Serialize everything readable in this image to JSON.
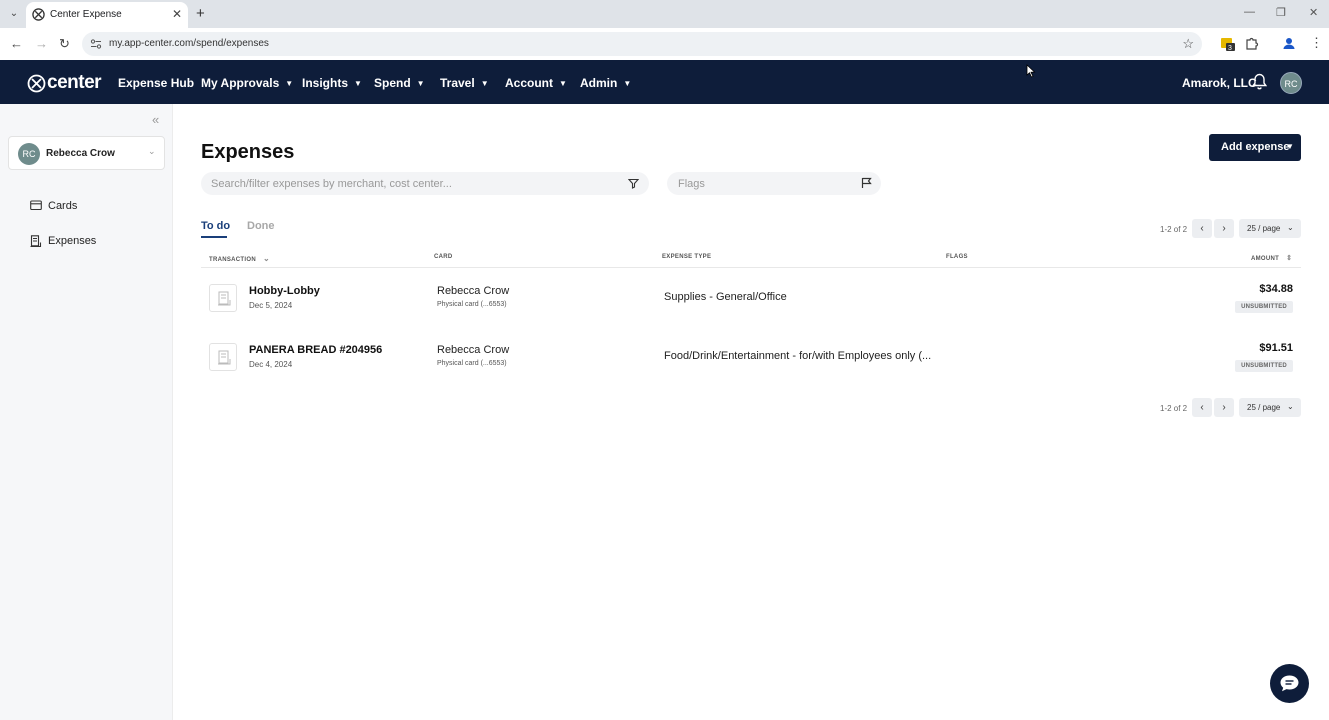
{
  "browser": {
    "tab_title": "Center Expense",
    "url": "my.app-center.com/spend/expenses",
    "extension_badge": "3"
  },
  "nav": {
    "brand": "center",
    "items": [
      {
        "label": "Expense Hub",
        "has_caret": false
      },
      {
        "label": "My Approvals",
        "has_caret": true
      },
      {
        "label": "Insights",
        "has_caret": true
      },
      {
        "label": "Spend",
        "has_caret": true
      },
      {
        "label": "Travel",
        "has_caret": true
      },
      {
        "label": "Account",
        "has_caret": true
      },
      {
        "label": "Admin",
        "has_caret": true
      }
    ],
    "org": "Amarok, LLC",
    "avatar_initials": "RC"
  },
  "sidebar": {
    "user": {
      "initials": "RC",
      "name": "Rebecca Crow"
    },
    "links": [
      {
        "label": "Cards",
        "icon": "credit-card-icon"
      },
      {
        "label": "Expenses",
        "icon": "receipt-icon"
      }
    ]
  },
  "main": {
    "title": "Expenses",
    "add_button": "Add expense",
    "search_placeholder": "Search/filter expenses by merchant, cost center...",
    "flags_placeholder": "Flags",
    "tabs": [
      "To do",
      "Done"
    ],
    "pager": {
      "count": "1-2 of 2",
      "page_size": "25 / page"
    },
    "columns": [
      "TRANSACTION",
      "CARD",
      "EXPENSE TYPE",
      "FLAGS",
      "AMOUNT"
    ],
    "rows": [
      {
        "merchant": "Hobby-Lobby",
        "date": "Dec 5, 2024",
        "card_holder": "Rebecca Crow",
        "card_desc": "Physical card (...6553)",
        "expense_type": "Supplies - General/Office",
        "amount": "$34.88",
        "status": "UNSUBMITTED"
      },
      {
        "merchant": "PANERA BREAD #204956",
        "date": "Dec 4, 2024",
        "card_holder": "Rebecca Crow",
        "card_desc": "Physical card (...6553)",
        "expense_type": "Food/Drink/Entertainment - for/with Employees only (...",
        "amount": "$91.51",
        "status": "UNSUBMITTED"
      }
    ]
  },
  "colors": {
    "nav_bg": "#0e1d3a",
    "active_tab": "#1a3f7a",
    "avatar": "#6f8c8c"
  }
}
